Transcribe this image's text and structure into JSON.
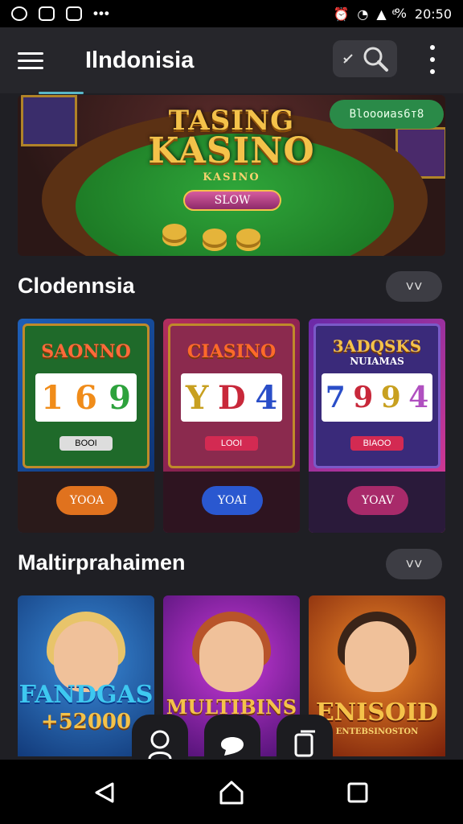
{
  "status_bar": {
    "battery": "ͤ%",
    "time": "20:50",
    "left_dots": "•••"
  },
  "header": {
    "title": "Ilndonisia"
  },
  "banner": {
    "title_top": "TASING",
    "title_main": "KASINO",
    "subtitle": "KASINO",
    "button_label": "SLOW",
    "badge_label": "Bloooиas6т8"
  },
  "section1": {
    "title": "Clodennsia",
    "more_label": "˅˅",
    "cards": [
      {
        "label": "SAONNO",
        "reels": [
          "1",
          "6",
          "9"
        ],
        "plate": "BOOI",
        "pad": "YOOA"
      },
      {
        "label": "CIASINO",
        "reels": [
          "Y",
          "D",
          "4"
        ],
        "plate": "LOOI",
        "pad": "YOAI"
      },
      {
        "label": "3ADQSKS",
        "sub": "NUIAMAS",
        "reels": [
          "7",
          "9",
          "9"
        ],
        "extra": "4",
        "plate": "BIAOO",
        "pad": "YOAV"
      }
    ]
  },
  "section2": {
    "title": "Maltirprahaimen",
    "more_label": "˅˅",
    "cards": [
      {
        "title": "FANDGAS",
        "sub": "+52000"
      },
      {
        "title": "MULTIBINS"
      },
      {
        "title": "ENISOID",
        "sub": "ENTEBSINOSTON"
      }
    ]
  },
  "colors": {
    "background": "#1f1f24",
    "header": "#26262b",
    "accent_green": "#2a8a48",
    "gold": "#f4c24a"
  },
  "icons": [
    "menu-icon",
    "search-icon",
    "more-vert-icon",
    "back-icon",
    "home-icon",
    "recents-icon"
  ]
}
